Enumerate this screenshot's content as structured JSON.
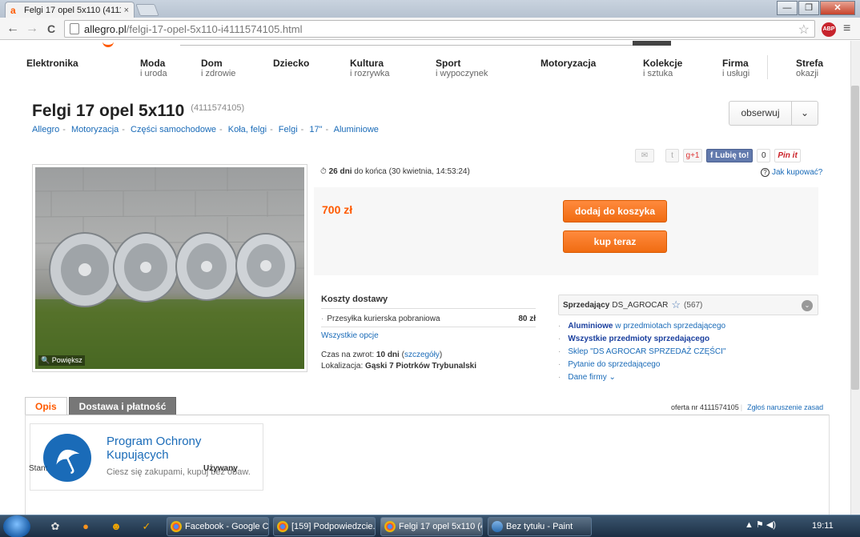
{
  "browser": {
    "tab_title": "Felgi 17 opel 5x110 (41115",
    "tab_close": "×",
    "url_domain": "allegro.pl",
    "url_path": "/felgi-17-opel-5x110-i4111574105.html",
    "back_glyph": "←",
    "forward_glyph": "→",
    "reload_glyph": "C",
    "star_glyph": "☆",
    "adblock_label": "ABP",
    "menu_glyph": "≡",
    "win_min": "—",
    "win_max": "❐",
    "win_close": "✕"
  },
  "categories": [
    {
      "title": "Elektronika",
      "sub": ""
    },
    {
      "title": "Moda",
      "sub": "i uroda"
    },
    {
      "title": "Dom",
      "sub": "i zdrowie"
    },
    {
      "title": "Dziecko",
      "sub": ""
    },
    {
      "title": "Kultura",
      "sub": "i rozrywka"
    },
    {
      "title": "Sport",
      "sub": "i wypoczynek"
    },
    {
      "title": "Motoryzacja",
      "sub": ""
    },
    {
      "title": "Kolekcje",
      "sub": "i sztuka"
    },
    {
      "title": "Firma",
      "sub": "i usługi"
    },
    {
      "title": "Strefa",
      "sub": "okazji"
    }
  ],
  "item": {
    "title": "Felgi 17 opel 5x110",
    "id": "(4111574105)",
    "breadcrumbs": [
      "Allegro",
      "Motoryzacja",
      "Części samochodowe",
      "Koła, felgi",
      "Felgi",
      "17\"",
      "Aluminiowe"
    ],
    "watch_label": "obserwuj",
    "watch_chevron": "⌄",
    "zoom_label": "Powiększ",
    "time_left_bold": "26 dni",
    "time_left_rest": " do końca (30 kwietnia, 14:53:24)",
    "how_to_buy": "Jak kupować?",
    "price": "700 zł",
    "add_to_cart": "dodaj do koszyka",
    "buy_now": "kup teraz"
  },
  "social": {
    "gplus": "g+1",
    "fb_like": "Lubię to!",
    "fb_count": "0",
    "pin": "Pin it"
  },
  "shipping": {
    "heading": "Koszty dostawy",
    "method": "Przesyłka kurierska pobraniowa",
    "cost": "80 zł",
    "all_options": "Wszystkie opcje",
    "return_label": "Czas na zwrot:",
    "return_value": "10 dni",
    "return_details": "szczegóły",
    "location_label": "Lokalizacja:",
    "location_value": "Gąski 7 Piotrków Trybunalski"
  },
  "seller": {
    "label": "Sprzedający",
    "nick": "DS_AGROCAR",
    "score": "(567)",
    "links": [
      {
        "bold": "Aluminiowe",
        "rest": " w przedmiotach sprzedającego"
      },
      {
        "bold": "Wszystkie przedmioty sprzedającego",
        "rest": ""
      },
      {
        "bold": "",
        "rest": "Sklep \"DS AGROCAR SPRZEDAŻ CZĘŚCI\""
      },
      {
        "bold": "",
        "rest": "Pytanie do sprzedającego"
      },
      {
        "bold": "",
        "rest": "Dane firmy  ⌄"
      }
    ]
  },
  "tabs": {
    "desc": "Opis",
    "delivery": "Dostawa i płatność",
    "offer_nr": "oferta nr 4111574105",
    "report": "Zgłoś naruszenie zasad"
  },
  "protection": {
    "title": "Program Ochrony Kupujących",
    "subtitle": "Ciesz się zakupami, kupuj bez obaw."
  },
  "condition": {
    "label": "Stan:",
    "value": "Używany"
  },
  "taskbar": {
    "tasks": [
      {
        "label": "Facebook - Google C...",
        "active": false
      },
      {
        "label": "[159] Podpowiedzcie...",
        "active": false
      },
      {
        "label": "Felgi 17 opel 5x110 (4...",
        "active": true
      },
      {
        "label": "Bez tytułu - Paint",
        "active": false
      }
    ],
    "clock": "19:11",
    "tray": "▲  ⚑  ◀)"
  }
}
